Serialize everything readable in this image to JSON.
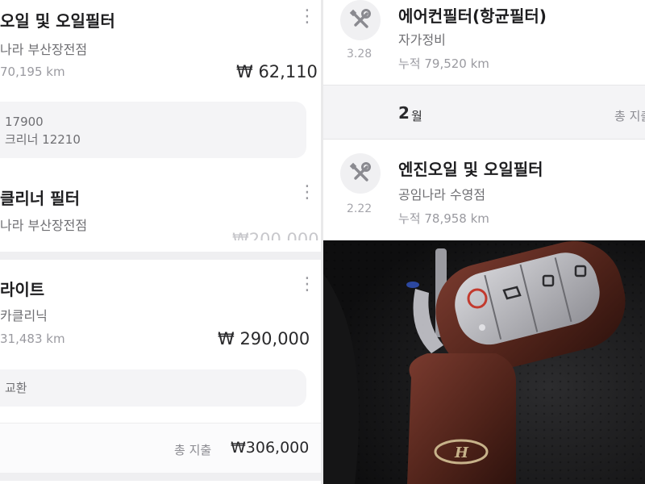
{
  "top_left": {
    "title": "오일 및 오일필터",
    "shop": "나라 부산장전점",
    "km": "70,195 km",
    "price": "₩ 62,110",
    "memo_line1": "17900",
    "memo_line2": "크리너 12210",
    "title2": "클리너 필터",
    "shop2": "나라 부산장전점",
    "price2_partial": "₩200,000"
  },
  "bottom_left": {
    "title": "라이트",
    "shop": "카클리닉",
    "km": "31,483 km",
    "price": "₩ 290,000",
    "memo": "교환",
    "total_label": "총 지출",
    "total_value": "₩306,000"
  },
  "top_right": {
    "item1": {
      "title": "에어컨필터(항균필터)",
      "shop": "자가정비",
      "date": "3.28",
      "km": "누적 79,520 km"
    },
    "month": {
      "number": "2",
      "unit": "월",
      "total_label": "총 지출"
    },
    "item2": {
      "title": "엔진오일 및 오일필터",
      "shop": "공임나라 수영점",
      "date": "2.22",
      "km": "누적 78,958 km"
    }
  },
  "photo": {
    "emblem": "H"
  },
  "colors": {
    "divider": "#e9e9ea",
    "card_fill": "#f4f4f6",
    "key_leather": "#5a2a22",
    "car_interior": "#1b1b1b"
  },
  "icons": [
    "wrench-screwdriver-icon",
    "more-vert-icon"
  ]
}
